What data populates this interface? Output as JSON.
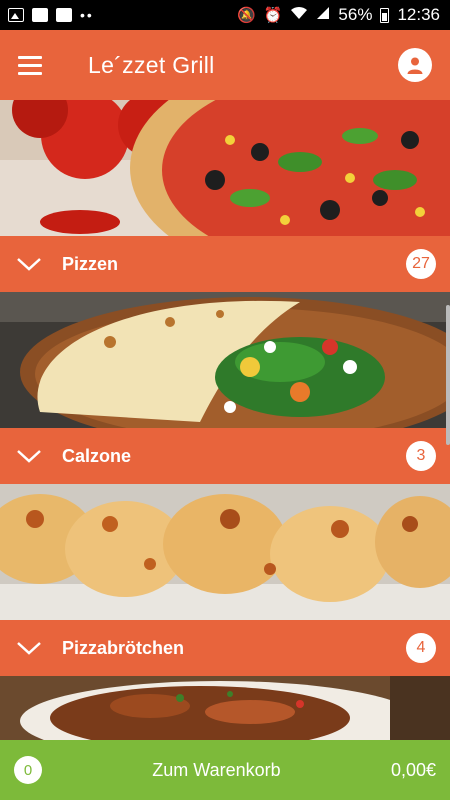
{
  "status_bar": {
    "battery": "56%",
    "time": "12:36"
  },
  "header": {
    "title": "Le´zzet Grill"
  },
  "categories": [
    {
      "label": "Pizzen",
      "count": "27"
    },
    {
      "label": "Calzone",
      "count": "3"
    },
    {
      "label": "Pizzabrötchen",
      "count": "4"
    }
  ],
  "cart": {
    "count": "0",
    "label": "Zum Warenkorb",
    "total": "0,00€"
  },
  "colors": {
    "accent": "#e8643c",
    "cart": "#7dba3a"
  }
}
